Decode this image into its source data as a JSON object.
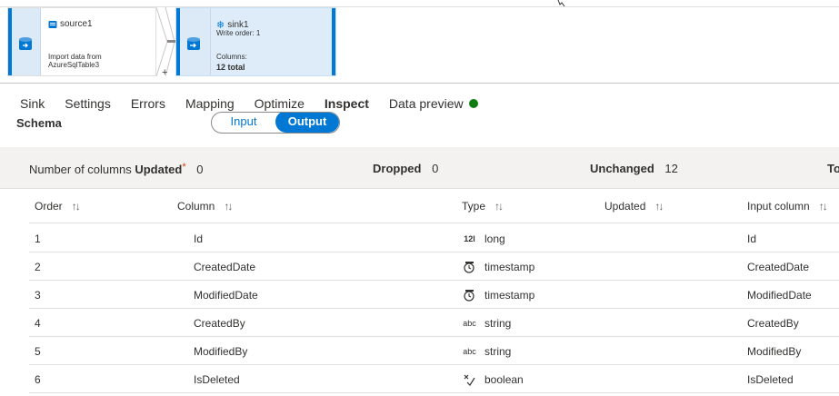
{
  "flow": {
    "source": {
      "name": "source1",
      "description": "Import data from AzureSqlTable3"
    },
    "sink": {
      "name": "sink1",
      "write_order": "Write order: 1",
      "columns_label": "Columns:",
      "columns_total": "12 total"
    },
    "add_symbol": "+"
  },
  "tabs": [
    {
      "label": "Sink",
      "active": false
    },
    {
      "label": "Settings",
      "active": false
    },
    {
      "label": "Errors",
      "active": false
    },
    {
      "label": "Mapping",
      "active": false
    },
    {
      "label": "Optimize",
      "active": false
    },
    {
      "label": "Inspect",
      "active": true
    },
    {
      "label": "Data preview",
      "active": false,
      "status_color": "#107c10"
    }
  ],
  "schema": {
    "label": "Schema",
    "toggle": {
      "input": "Input",
      "output": "Output",
      "selected": "Output"
    }
  },
  "summary": {
    "columns_label": "Number of columns",
    "updated_label": "Updated",
    "updated_mark": "*",
    "updated_value": "0",
    "dropped_label": "Dropped",
    "dropped_value": "0",
    "unchanged_label": "Unchanged",
    "unchanged_value": "12",
    "total_label": "To"
  },
  "table": {
    "headers": {
      "order": "Order",
      "column": "Column",
      "type": "Type",
      "updated": "Updated",
      "input_column": "Input column"
    },
    "rows": [
      {
        "order": "1",
        "column": "Id",
        "type_icon": "integer-icon",
        "type_glyph": "12l",
        "type": "long",
        "updated": "",
        "input_column": "Id"
      },
      {
        "order": "2",
        "column": "CreatedDate",
        "type_icon": "timestamp-icon",
        "type_glyph": "",
        "type": "timestamp",
        "updated": "",
        "input_column": "CreatedDate"
      },
      {
        "order": "3",
        "column": "ModifiedDate",
        "type_icon": "timestamp-icon",
        "type_glyph": "",
        "type": "timestamp",
        "updated": "",
        "input_column": "ModifiedDate"
      },
      {
        "order": "4",
        "column": "CreatedBy",
        "type_icon": "string-icon",
        "type_glyph": "abc",
        "type": "string",
        "updated": "",
        "input_column": "CreatedBy"
      },
      {
        "order": "5",
        "column": "ModifiedBy",
        "type_icon": "string-icon",
        "type_glyph": "abc",
        "type": "string",
        "updated": "",
        "input_column": "ModifiedBy"
      },
      {
        "order": "6",
        "column": "IsDeleted",
        "type_icon": "boolean-icon",
        "type_glyph": "",
        "type": "boolean",
        "updated": "",
        "input_column": "IsDeleted"
      }
    ]
  },
  "colors": {
    "accent": "#0078d4",
    "status_ok": "#107c10",
    "updated_mark": "#d83b01"
  }
}
